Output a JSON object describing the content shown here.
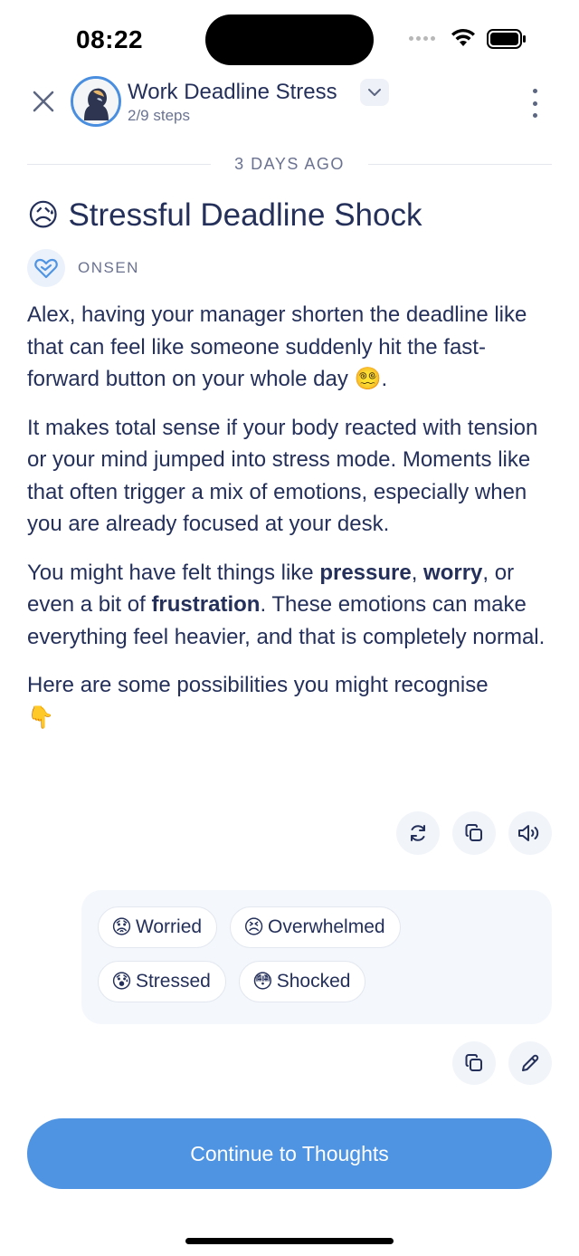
{
  "status_bar": {
    "time": "08:22"
  },
  "header": {
    "title": "Work Deadline Stress",
    "steps": "2/9 steps"
  },
  "conversation": {
    "date_label": "3 DAYS AGO",
    "message": {
      "title_emoji": "😥",
      "title": "Stressful Deadline Shock",
      "sender": "ONSEN",
      "paragraphs": {
        "p1": "Alex, having your manager shorten the deadline like that can feel like someone suddenly hit the fast-forward button on your whole day",
        "p1_emoji": "😵‍💫",
        "p1_end": ".",
        "p2": "It makes total sense if your body reacted with tension or your mind jumped into stress mode. Moments like that often trigger a mix of emotions, especially when you are already focused at your desk.",
        "p3_a": "You might have felt things like ",
        "p3_b1": "pressure",
        "p3_sep1": ", ",
        "p3_b2": "worry",
        "p3_sep2": ", or even a bit of ",
        "p3_b3": "frustration",
        "p3_c": ". These emotions can make everything feel heavier, and that is completely normal.",
        "p4": "Here are some possibilities you might recognise",
        "p4_emoji": "👇"
      }
    },
    "reply": {
      "chips": [
        {
          "emoji": "😟",
          "label": "Worried"
        },
        {
          "emoji": "😣",
          "label": "Overwhelmed"
        },
        {
          "emoji": "😰",
          "label": "Stressed"
        },
        {
          "emoji": "😳",
          "label": "Shocked"
        }
      ]
    }
  },
  "cta": {
    "label": "Continue to Thoughts"
  },
  "colors": {
    "accent": "#4f94e3",
    "text": "#24305a",
    "muted": "#6b7290"
  }
}
